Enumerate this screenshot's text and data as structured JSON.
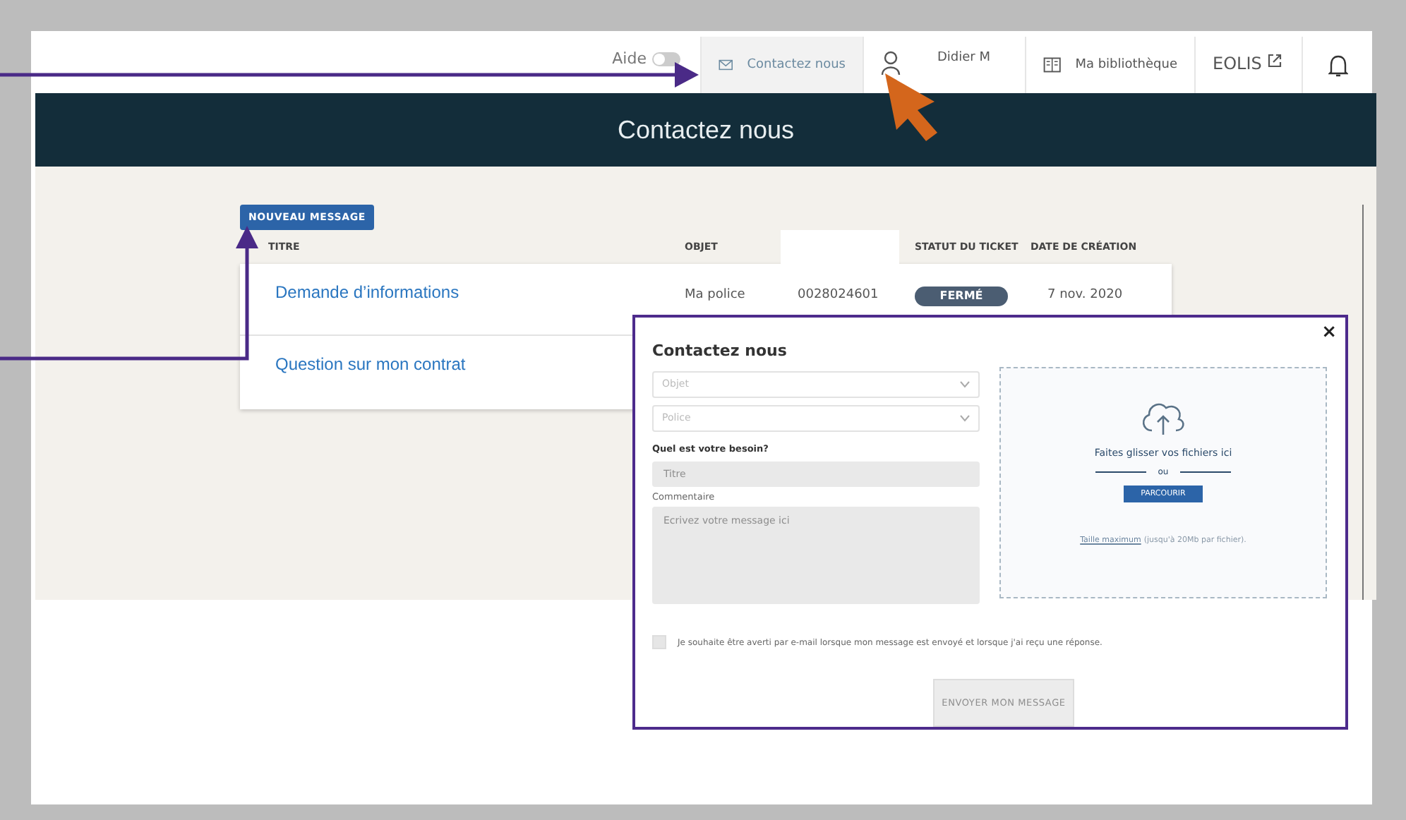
{
  "header": {
    "aide": {
      "label": "Aide",
      "on": false
    },
    "nav": [
      {
        "kind": "mail",
        "label": "Contactez nous",
        "selected": true
      },
      {
        "kind": "user",
        "label": "Didier M",
        "selected": false
      },
      {
        "kind": "book",
        "label": "Ma bibliothèque",
        "selected": false
      },
      {
        "kind": "external",
        "label": "EOLIS",
        "selected": false
      },
      {
        "kind": "bell",
        "selected": false
      }
    ]
  },
  "banner": {
    "title": "Contactez nous"
  },
  "new_message_button": "NOUVEAU MESSAGE",
  "table": {
    "columns": [
      {
        "kind": "text",
        "label": "TITRE"
      },
      {
        "kind": "text",
        "label": "OBJET"
      },
      {
        "kind": "blank"
      },
      {
        "kind": "text",
        "label": "STATUT DU TICKET"
      },
      {
        "kind": "text",
        "label": "DATE DE CRÉATION"
      }
    ],
    "rows": [
      {
        "title": "Demande d’informations",
        "objet": "Ma police",
        "column_3": "0028024601",
        "status": {
          "label": "FERMÉ",
          "color": "#4b5d72"
        },
        "date": "7 nov. 2020"
      },
      {
        "title": "Question sur mon contrat"
      }
    ]
  },
  "modal": {
    "title": "Contactez nous",
    "close": "×",
    "selects": [
      {
        "placeholder": "Objet"
      },
      {
        "placeholder": "Police"
      }
    ],
    "need_label": "Quel est votre besoin?",
    "title_field": {
      "placeholder": "Titre",
      "disabled": true
    },
    "comment_label": "Commentaire",
    "comment_field": {
      "placeholder": "Ecrivez votre message ici",
      "disabled": true
    },
    "notify": {
      "label": "Je souhaite être averti par e-mail lorsque mon message est envoyé et lorsque j'ai reçu une réponse.",
      "checked": false
    },
    "send_button": {
      "label": "ENVOYER MON MESSAGE",
      "disabled": true
    },
    "dropzone": {
      "text": "Faites glisser vos fichiers ici",
      "separator": "ou",
      "browse_button": "PARCOURIR",
      "size_link": "Taille maximum",
      "size_note": "(jusqu'à 20Mb par fichier)."
    }
  }
}
